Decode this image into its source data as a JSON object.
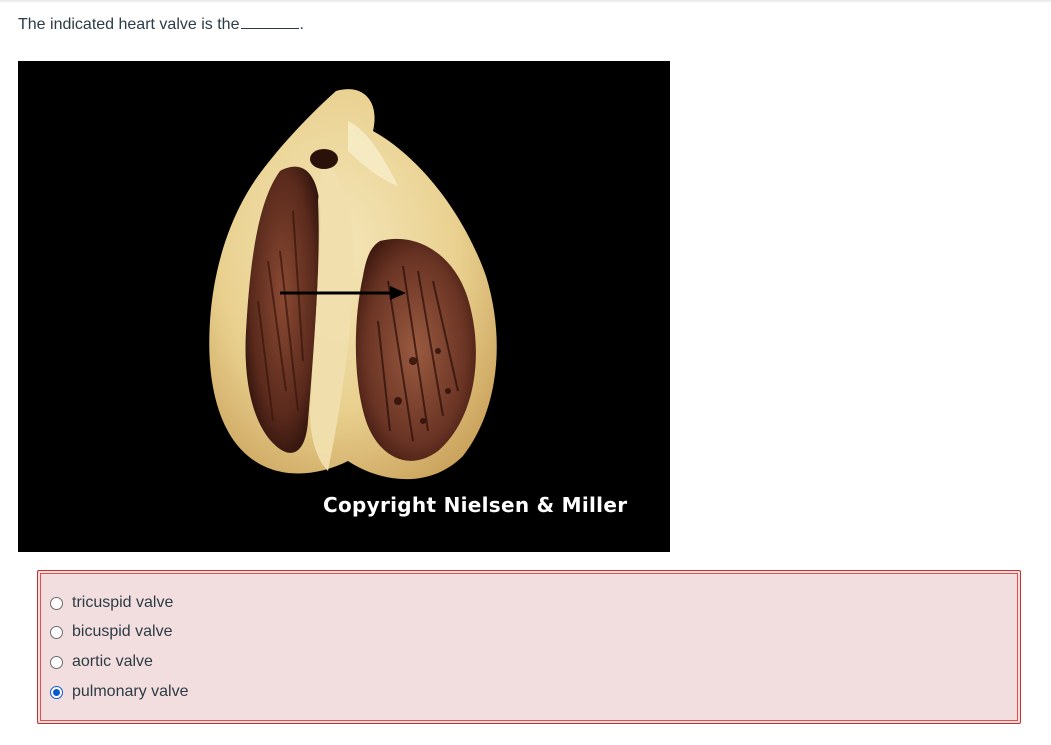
{
  "question": {
    "text": "The indicated heart valve is the"
  },
  "image": {
    "subject": "sectioned heart with arrow pointing to valve",
    "watermark": "Copyright Nielsen & Miller",
    "background_color": "#000000"
  },
  "answers": {
    "options": [
      {
        "label": "tricuspid valve",
        "selected": false
      },
      {
        "label": "bicuspid valve",
        "selected": false
      },
      {
        "label": "aortic valve",
        "selected": false
      },
      {
        "label": "pulmonary valve",
        "selected": true
      }
    ],
    "box_background": "#f2dede",
    "box_border": "#d9534f",
    "selected_color": "#0b57d0"
  }
}
